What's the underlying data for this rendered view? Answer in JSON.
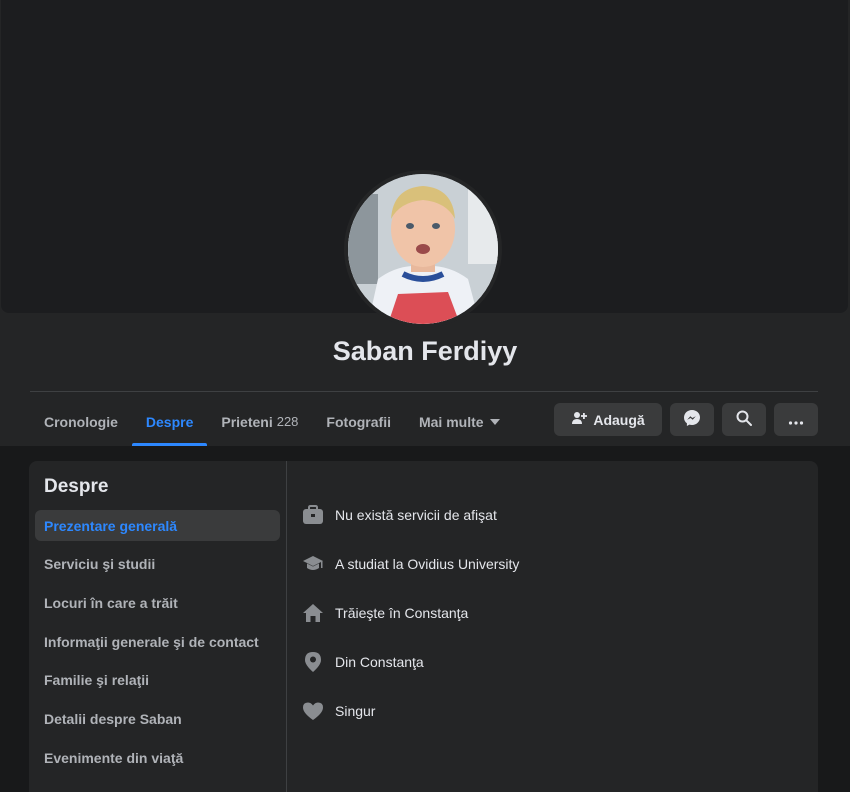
{
  "profile": {
    "name": "Saban Ferdiyy"
  },
  "tabs": [
    {
      "label": "Cronologie",
      "count": ""
    },
    {
      "label": "Despre",
      "count": ""
    },
    {
      "label": "Prieteni",
      "count": "228"
    },
    {
      "label": "Fotografii",
      "count": ""
    },
    {
      "label": "Mai multe",
      "count": ""
    }
  ],
  "active_tab": "Despre",
  "actions": {
    "add_label": "Adaugă",
    "add_icon": "add-friend-icon",
    "messenger_icon": "messenger-icon",
    "search_icon": "search-icon",
    "more_icon": "more-icon"
  },
  "about": {
    "title": "Despre",
    "sidebar": [
      "Prezentare generală",
      "Serviciu şi studii",
      "Locuri în care a trăit",
      "Informaţii generale şi de contact",
      "Familie şi relaţii",
      "Detalii despre Saban",
      "Evenimente din viaţă"
    ],
    "active_item": "Prezentare generală",
    "overview": [
      {
        "icon": "briefcase-icon",
        "text": "Nu există servicii de afişat"
      },
      {
        "icon": "graduation-cap-icon",
        "text": "A studiat la Ovidius University"
      },
      {
        "icon": "home-icon",
        "text": "Trăieşte în Constanţa"
      },
      {
        "icon": "location-pin-icon",
        "text": "Din Constanţa"
      },
      {
        "icon": "heart-icon",
        "text": "Singur"
      }
    ]
  },
  "colors": {
    "accent": "#2d88ff",
    "background": "#18191a",
    "surface": "#242526",
    "button": "#3a3b3c"
  }
}
